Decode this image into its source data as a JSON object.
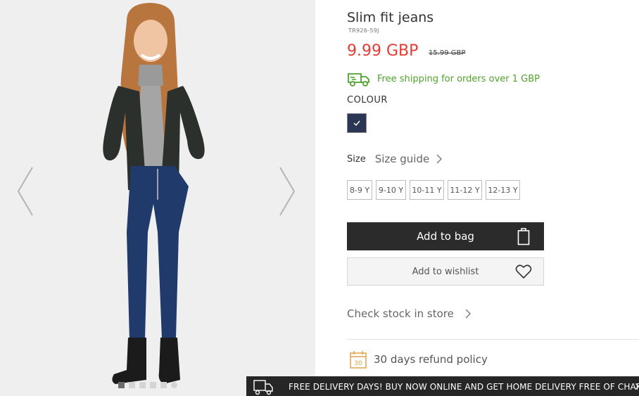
{
  "product": {
    "title": "Slim fit jeans",
    "sku": "TR926-59J",
    "price": "9.99 GBP",
    "old_price": "15.99 GBP"
  },
  "shipping": {
    "text": "Free shipping for orders over 1 GBP",
    "icon": "truck-icon",
    "color": "#4fa22b"
  },
  "colour": {
    "label": "COLOUR",
    "selected_color": "#2b3554",
    "icon": "check-icon"
  },
  "size": {
    "label": "Size",
    "guide_label": "Size guide",
    "options": [
      "8-9 Y",
      "9-10 Y",
      "10-11 Y",
      "11-12 Y",
      "12-13 Y"
    ]
  },
  "actions": {
    "add_to_bag": "Add to bag",
    "add_to_wishlist": "Add to wishlist",
    "check_stock": "Check stock in store"
  },
  "refund": {
    "text": "30 days refund policy",
    "icon_text": "30"
  },
  "banner": {
    "text": "FREE DELIVERY DAYS! BUY NOW ONLINE AND GET HOME DELIVERY FREE OF CHARGE!",
    "close": "×"
  },
  "gallery": {
    "image_count": 6,
    "active_index": 0
  },
  "colors": {
    "price": "#e53b32",
    "accent_green": "#4fa22b",
    "button_dark": "#2b2b2b",
    "refund_orange": "#e3a24a"
  }
}
